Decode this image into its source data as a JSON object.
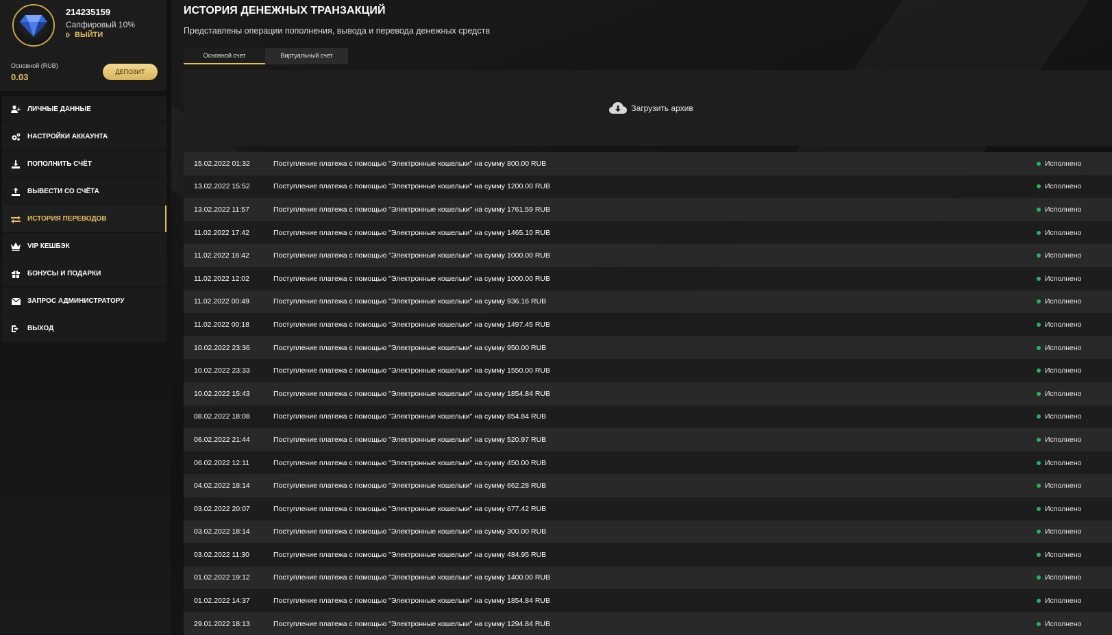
{
  "profile": {
    "user_id": "214235159",
    "level": "Сапфировый 10%",
    "logout_label": "ВЫЙТИ",
    "balance_label": "Основной (RUB)",
    "balance_value": "0.03",
    "deposit_label": "ДЕПОЗИТ"
  },
  "menu": [
    {
      "label": "ЛИЧНЫЕ ДАННЫЕ",
      "icon": "user-plus-icon"
    },
    {
      "label": "НАСТРОЙКИ АККАУНТА",
      "icon": "cogs-icon"
    },
    {
      "label": "ПОПОЛНИТЬ СЧЁТ",
      "icon": "download-icon"
    },
    {
      "label": "ВЫВЕСТИ СО СЧЁТА",
      "icon": "upload-icon"
    },
    {
      "label": "ИСТОРИЯ ПЕРЕВОДОВ",
      "icon": "transfer-arrows-icon",
      "active": true
    },
    {
      "label": "VIP КЕШБЭК",
      "icon": "crown-icon"
    },
    {
      "label": "БОНУСЫ И ПОДАРКИ",
      "icon": "gift-icon"
    },
    {
      "label": "ЗАПРОС АДМИНИСТРАТОРУ",
      "icon": "envelope-icon"
    },
    {
      "label": "ВЫХОД",
      "icon": "sign-out-icon"
    }
  ],
  "main": {
    "title": "ИСТОРИЯ ДЕНЕЖНЫХ ТРАНЗАКЦИЙ",
    "subtitle": "Представлены операции пополнения, вывода и перевода денежных средств",
    "tabs": [
      {
        "label": "Основной счет",
        "active": true
      },
      {
        "label": "Виртуальный счет",
        "active": false
      }
    ],
    "archive_label": "Загрузить архив"
  },
  "transactions": [
    {
      "date": "15.02.2022 01:32",
      "desc": "Поступление платежа с помощью \"Электронные кошельки\" на сумму 800.00 RUB",
      "status": "Исполнено"
    },
    {
      "date": "13.02.2022 15:52",
      "desc": "Поступление платежа с помощью \"Электронные кошельки\" на сумму 1200.00 RUB",
      "status": "Исполнено"
    },
    {
      "date": "13.02.2022 11:57",
      "desc": "Поступление платежа с помощью \"Электронные кошельки\" на сумму 1761.59 RUB",
      "status": "Исполнено"
    },
    {
      "date": "11.02.2022 17:42",
      "desc": "Поступление платежа с помощью \"Электронные кошельки\" на сумму 1465.10 RUB",
      "status": "Исполнено"
    },
    {
      "date": "11.02.2022 16:42",
      "desc": "Поступление платежа с помощью \"Электронные кошельки\" на сумму 1000.00 RUB",
      "status": "Исполнено"
    },
    {
      "date": "11.02.2022 12:02",
      "desc": "Поступление платежа с помощью \"Электронные кошельки\" на сумму 1000.00 RUB",
      "status": "Исполнено"
    },
    {
      "date": "11.02.2022 00:49",
      "desc": "Поступление платежа с помощью \"Электронные кошельки\" на сумму 936.16 RUB",
      "status": "Исполнено"
    },
    {
      "date": "11.02.2022 00:18",
      "desc": "Поступление платежа с помощью \"Электронные кошельки\" на сумму 1497.45 RUB",
      "status": "Исполнено"
    },
    {
      "date": "10.02.2022 23:36",
      "desc": "Поступление платежа с помощью \"Электронные кошельки\" на сумму 950.00 RUB",
      "status": "Исполнено"
    },
    {
      "date": "10.02.2022 23:33",
      "desc": "Поступление платежа с помощью \"Электронные кошельки\" на сумму 1550.00 RUB",
      "status": "Исполнено"
    },
    {
      "date": "10.02.2022 15:43",
      "desc": "Поступление платежа с помощью \"Электронные кошельки\" на сумму 1854.84 RUB",
      "status": "Исполнено"
    },
    {
      "date": "08.02.2022 18:08",
      "desc": "Поступление платежа с помощью \"Электронные кошельки\" на сумму 854.84 RUB",
      "status": "Исполнено"
    },
    {
      "date": "06.02.2022 21:44",
      "desc": "Поступление платежа с помощью \"Электронные кошельки\" на сумму 520.97 RUB",
      "status": "Исполнено"
    },
    {
      "date": "06.02.2022 12:11",
      "desc": "Поступление платежа с помощью \"Электронные кошельки\" на сумму 450.00 RUB",
      "status": "Исполнено"
    },
    {
      "date": "04.02.2022 18:14",
      "desc": "Поступление платежа с помощью \"Электронные кошельки\" на сумму 662.28 RUB",
      "status": "Исполнено"
    },
    {
      "date": "03.02.2022 20:07",
      "desc": "Поступление платежа с помощью \"Электронные кошельки\" на сумму 677.42 RUB",
      "status": "Исполнено"
    },
    {
      "date": "03.02.2022 18:14",
      "desc": "Поступление платежа с помощью \"Электронные кошельки\" на сумму 300.00 RUB",
      "status": "Исполнено"
    },
    {
      "date": "03.02.2022 11:30",
      "desc": "Поступление платежа с помощью \"Электронные кошельки\" на сумму 484.95 RUB",
      "status": "Исполнено"
    },
    {
      "date": "01.02.2022 19:12",
      "desc": "Поступление платежа с помощью \"Электронные кошельки\" на сумму 1400.00 RUB",
      "status": "Исполнено"
    },
    {
      "date": "01.02.2022 14:37",
      "desc": "Поступление платежа с помощью \"Электронные кошельки\" на сумму 1854.84 RUB",
      "status": "Исполнено"
    },
    {
      "date": "29.01.2022 18:13",
      "desc": "Поступление платежа с помощью \"Электронные кошельки\" на сумму 1294.84 RUB",
      "status": "Исполнено"
    }
  ],
  "colors": {
    "accent": "#e6c15c",
    "status_ok": "#21b85a",
    "background": "#141414"
  }
}
